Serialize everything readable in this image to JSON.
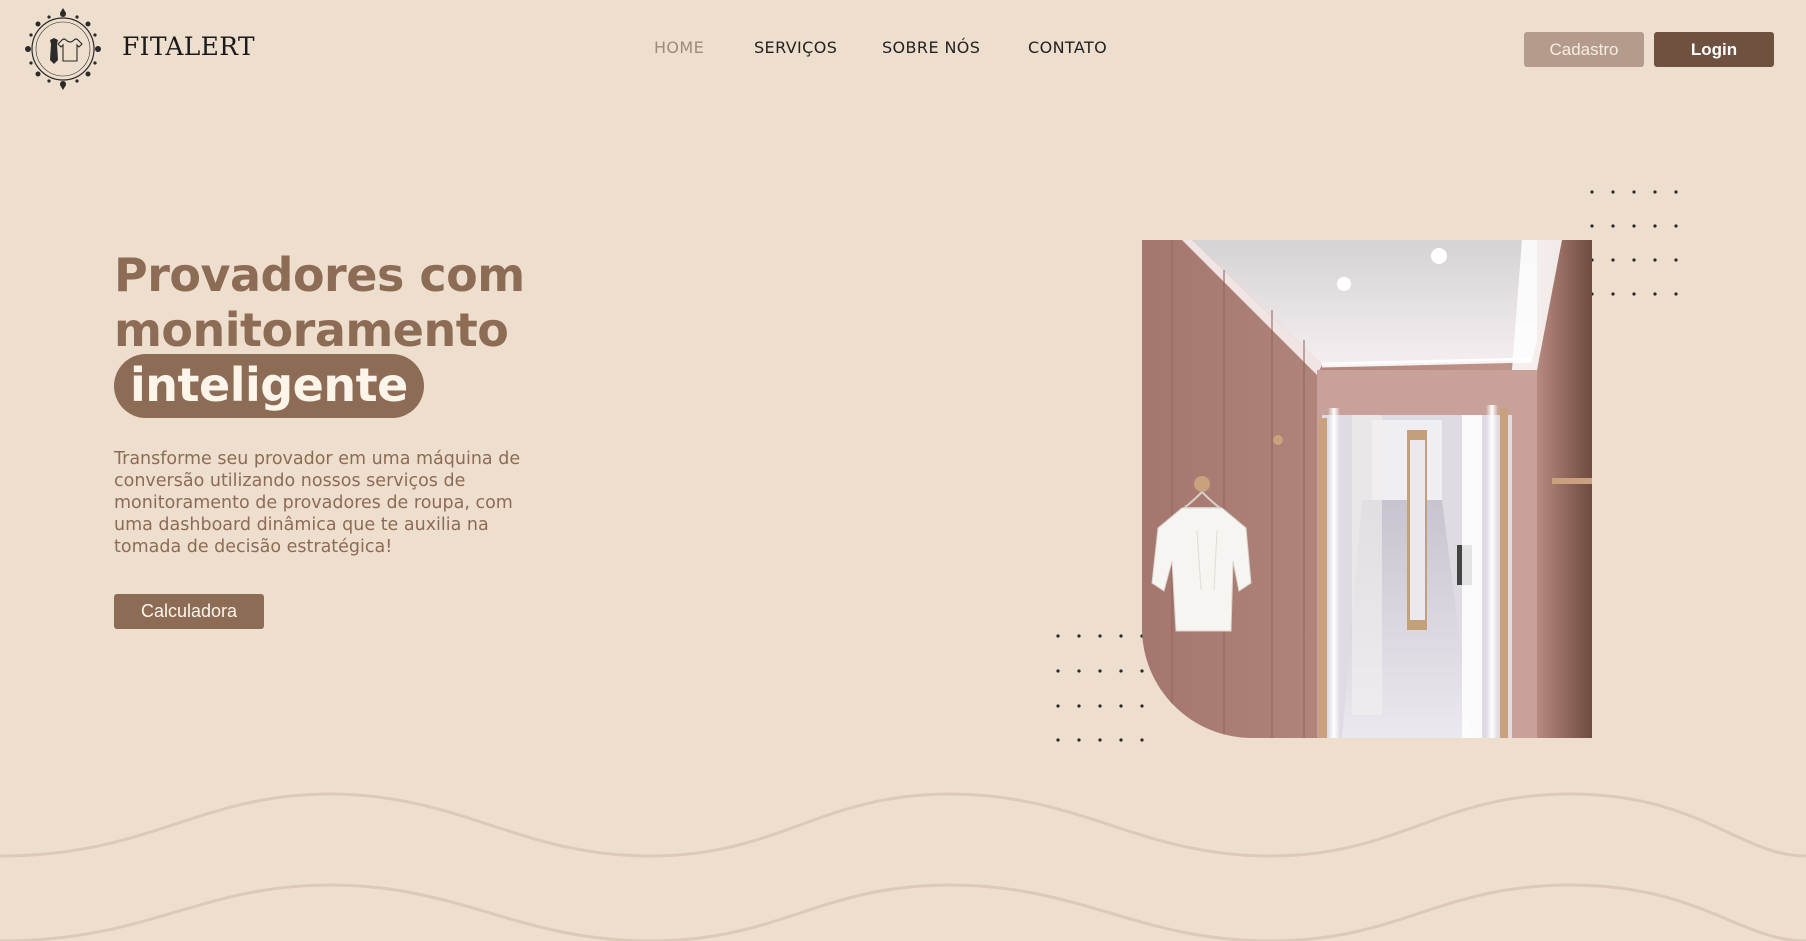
{
  "brand": {
    "name": "FITALERT",
    "logo_icon": "ornamental-wreath-logo-icon"
  },
  "nav": {
    "items": [
      {
        "label": "HOME",
        "active": true
      },
      {
        "label": "SERVIÇOS",
        "active": false
      },
      {
        "label": "SOBRE NÓS",
        "active": false
      },
      {
        "label": "CONTATO",
        "active": false
      }
    ]
  },
  "auth": {
    "signup_label": "Cadastro",
    "login_label": "Login"
  },
  "hero": {
    "title_line1": "Provadores com",
    "title_line2": "monitoramento",
    "title_highlight": "inteligente",
    "description": "Transforme seu provador em uma máquina de conversão utilizando nossos serviços de monitoramento de provadores de roupa, com uma dashboard dinâmica que te auxilia na tomada de decisão estratégica!",
    "cta_label": "Calculadora",
    "image_icon": "fitting-room-photo"
  },
  "colors": {
    "background": "#eedecd",
    "accent": "#8d6c56",
    "signup_button": "#b59b8b",
    "login_button": "#6f5140",
    "wave": "#dcc9b8"
  }
}
